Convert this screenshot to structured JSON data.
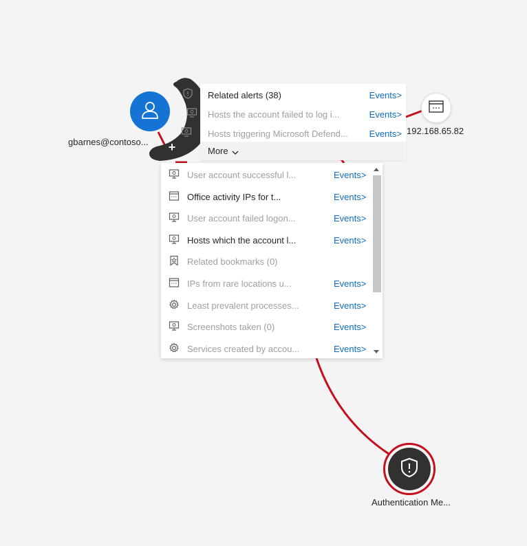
{
  "nodes": {
    "user": {
      "label": "gbarnes@contoso..."
    },
    "ip": {
      "label": "192.168.65.82"
    },
    "alert": {
      "label": "Authentication Me..."
    }
  },
  "top_menu": {
    "items": [
      {
        "label": "Related alerts (38)",
        "events": "Events>",
        "muted": false
      },
      {
        "label": "Hosts the account failed to log i...",
        "events": "Events>",
        "muted": true
      },
      {
        "label": "Hosts triggering Microsoft Defend...",
        "events": "Events>",
        "muted": true
      }
    ],
    "more_label": "More"
  },
  "dropdown": {
    "items": [
      {
        "icon": "monitor-icon",
        "label": "User account successful l...",
        "events": "Events>",
        "muted": true
      },
      {
        "icon": "window-icon",
        "label": "Office activity IPs for t...",
        "events": "Events>",
        "muted": false
      },
      {
        "icon": "monitor-icon",
        "label": "User account failed logon...",
        "events": "Events>",
        "muted": true
      },
      {
        "icon": "monitor-icon",
        "label": "Hosts which the account l...",
        "events": "Events>",
        "muted": false
      },
      {
        "icon": "bookmark-icon",
        "label": "Related bookmarks (0)",
        "events": "",
        "muted": true
      },
      {
        "icon": "window-icon",
        "label": "IPs from rare locations u...",
        "events": "Events>",
        "muted": true
      },
      {
        "icon": "gear-icon",
        "label": "Least prevalent processes...",
        "events": "Events>",
        "muted": true
      },
      {
        "icon": "monitor-icon",
        "label": "Screenshots taken (0)",
        "events": "Events>",
        "muted": true
      },
      {
        "icon": "gear-icon",
        "label": "Services created by accou...",
        "events": "Events>",
        "muted": true
      }
    ]
  },
  "colors": {
    "edge": "#c50f1f",
    "user_node": "#1473d3",
    "arc": "#323130",
    "link": "#0f6cbd"
  }
}
